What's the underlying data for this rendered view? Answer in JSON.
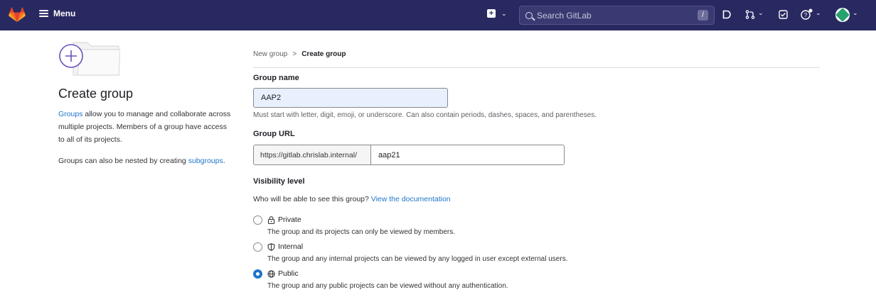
{
  "topbar": {
    "menu_label": "Menu",
    "search_placeholder": "Search GitLab",
    "search_shortcut": "/"
  },
  "left": {
    "title": "Create group",
    "groups_link": "Groups",
    "intro_text": " allow you to manage and collaborate across multiple projects. Members of a group have access to all of its projects.",
    "nested_text": "Groups can also be nested by creating ",
    "subgroups_link": "subgroups",
    "nested_end": "."
  },
  "breadcrumb": {
    "parent": "New group",
    "separator": ">",
    "current": "Create group"
  },
  "form": {
    "group_name_label": "Group name",
    "group_name_value": "AAP2",
    "group_name_help": "Must start with letter, digit, emoji, or underscore. Can also contain periods, dashes, spaces, and parentheses.",
    "group_url_label": "Group URL",
    "group_url_prefix": "https://gitlab.chrislab.internal/",
    "group_url_value": "aap21",
    "visibility_label": "Visibility level",
    "visibility_question": "Who will be able to see this group? ",
    "visibility_doc_link": "View the documentation",
    "visibility_options": [
      {
        "label": "Private",
        "icon": "lock-icon",
        "description": "The group and its projects can only be viewed by members.",
        "selected": false
      },
      {
        "label": "Internal",
        "icon": "shield-icon",
        "description": "The group and any internal projects can be viewed by any logged in user except external users.",
        "selected": false
      },
      {
        "label": "Public",
        "icon": "globe-icon",
        "description": "The group and any public projects can be viewed without any authentication.",
        "selected": true
      }
    ]
  },
  "colors": {
    "topbar_bg": "#292961",
    "link": "#1f75cb",
    "accent_purple": "#6b4fbb"
  }
}
